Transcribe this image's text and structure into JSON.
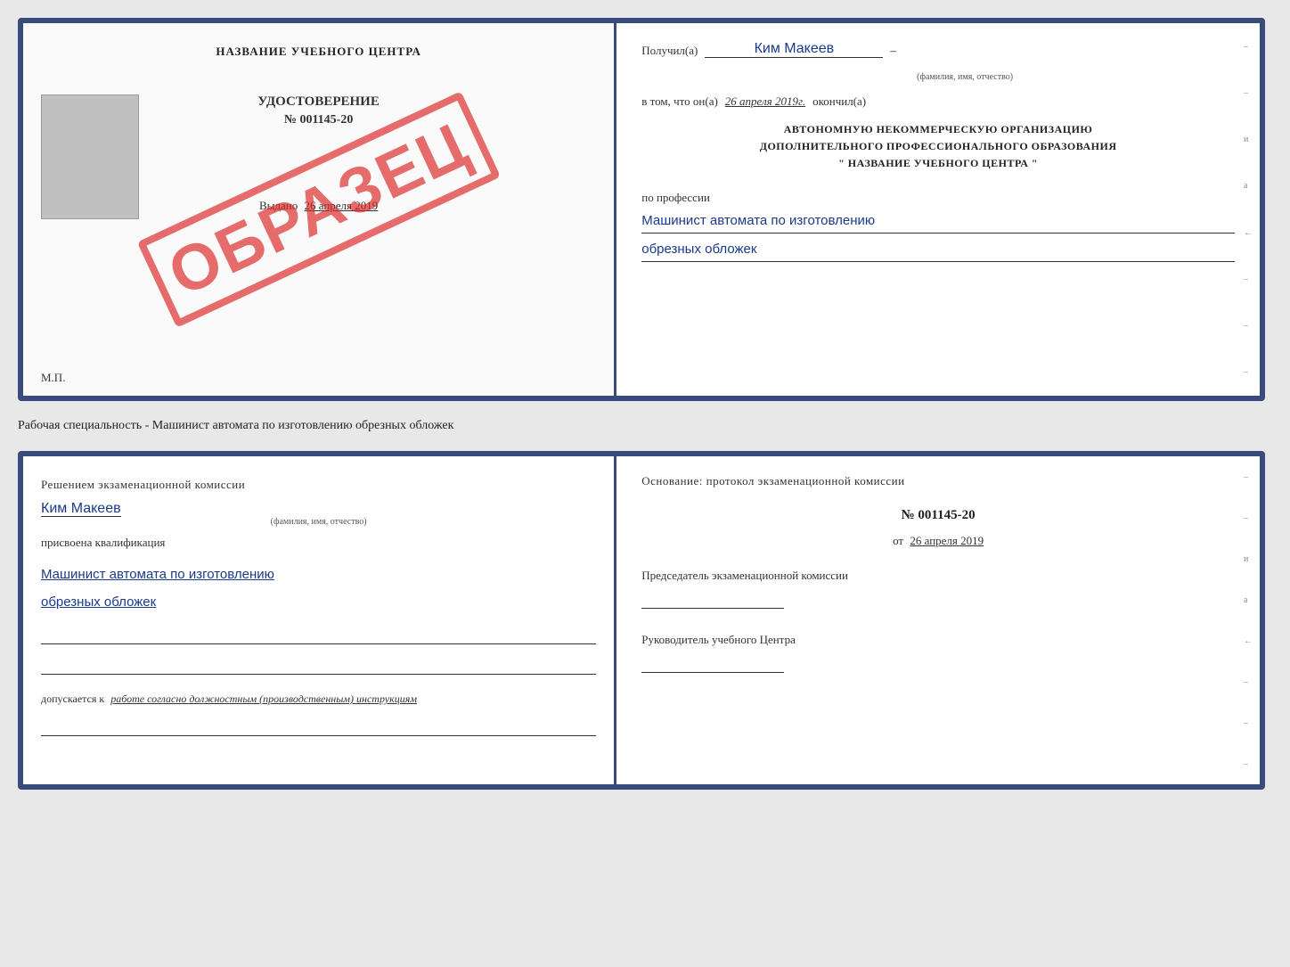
{
  "top_document": {
    "left": {
      "training_center_title": "НАЗВАНИЕ УЧЕБНОГО ЦЕНТРА",
      "certificate_label": "УДОСТОВЕРЕНИЕ",
      "certificate_number": "№ 001145-20",
      "photo_placeholder": "",
      "stamp": "ОБРАЗЕЦ",
      "issued_label": "Выдано",
      "issued_date": "26 апреля 2019",
      "mp": "М.П."
    },
    "right": {
      "received_prefix": "Получил(а)",
      "received_name": "Ким Макеев",
      "received_dash": "–",
      "fio_subtitle": "(фамилия, имя, отчество)",
      "date_prefix": "в том, что он(а)",
      "date_value": "26 апреля 2019г.",
      "date_suffix": "окончил(а)",
      "org_line1": "АВТОНОМНУЮ НЕКОММЕРЧЕСКУЮ ОРГАНИЗАЦИЮ",
      "org_line2": "ДОПОЛНИТЕЛЬНОГО ПРОФЕССИОНАЛЬНОГО ОБРАЗОВАНИЯ",
      "org_line3": "\"   НАЗВАНИЕ УЧЕБНОГО ЦЕНТРА   \"",
      "profession_label": "по профессии",
      "profession_line1": "Машинист автомата по изготовлению",
      "profession_line2": "обрезных обложек",
      "side_marks": [
        "–",
        "–",
        "и",
        "а",
        "←",
        "–",
        "–",
        "–"
      ]
    }
  },
  "middle_text": "Рабочая специальность - Машинист автомата по изготовлению обрезных обложек",
  "bottom_document": {
    "left": {
      "decision_text": "Решением экзаменационной комиссии",
      "person_name": "Ким Макеев",
      "fio_subtitle": "(фамилия, имя, отчество)",
      "qualification_label": "присвоена квалификация",
      "qualification_line1": "Машинист автомата по изготовлению",
      "qualification_line2": "обрезных обложек",
      "allowed_prefix": "допускается к",
      "allowed_value": "работе согласно должностным (производственным) инструкциям"
    },
    "right": {
      "basis_text": "Основание: протокол экзаменационной комиссии",
      "protocol_number": "№ 001145-20",
      "date_prefix": "от",
      "date_value": "26 апреля 2019",
      "chairman_label": "Председатель экзаменационной комиссии",
      "director_label": "Руководитель учебного Центра",
      "side_marks": [
        "–",
        "–",
        "и",
        "а",
        "←",
        "–",
        "–",
        "–"
      ]
    }
  }
}
